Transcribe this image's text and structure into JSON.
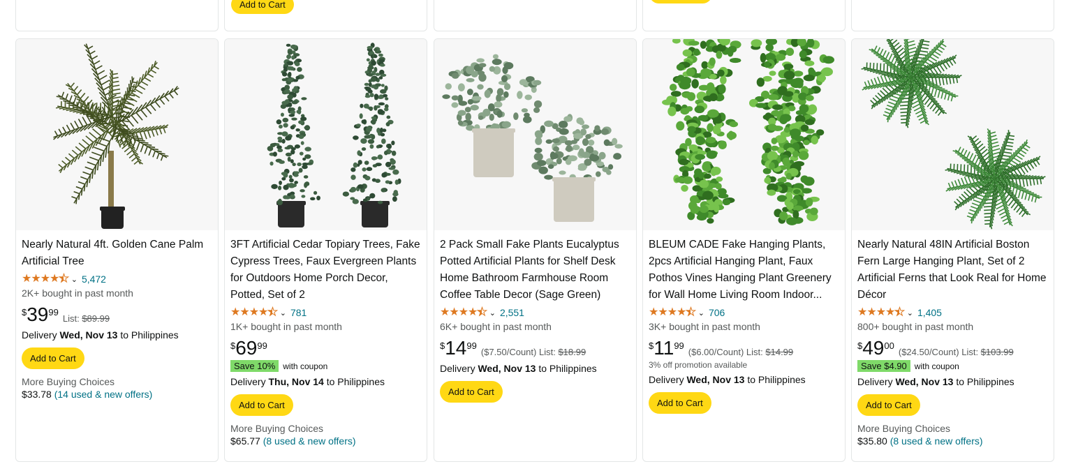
{
  "top_row": {
    "cart_label": "Add to Cart"
  },
  "products": [
    {
      "title": "Nearly Natural 4ft. Golden Cane Palm Artificial Tree",
      "rating": 4.5,
      "rating_count": "5,472",
      "bought": "2K+ bought in past month",
      "price_symbol": "$",
      "price_whole": "39",
      "price_fraction": "99",
      "unit_price": "",
      "list_label": "List:",
      "list_price": "$89.99",
      "coupon_badge": "",
      "coupon_text": "",
      "promo": "",
      "delivery_prefix": "Delivery",
      "delivery_date": "Wed, Nov 13",
      "delivery_suffix": "to Philippines",
      "cart_label": "Add to Cart",
      "more_buying": "More Buying Choices",
      "offer_price": "$33.78",
      "offer_link": "(14 used & new offers)",
      "image": "palm-tree"
    },
    {
      "title": "3FT Artificial Cedar Topiary Trees, Fake Cypress Trees, Faux Evergreen Plants for Outdoors Home Porch Decor, Potted, Set of 2",
      "rating": 4.5,
      "rating_count": "781",
      "bought": "1K+ bought in past month",
      "price_symbol": "$",
      "price_whole": "69",
      "price_fraction": "99",
      "unit_price": "",
      "list_label": "",
      "list_price": "",
      "coupon_badge": "Save 10%",
      "coupon_text": "with coupon",
      "promo": "",
      "delivery_prefix": "Delivery",
      "delivery_date": "Thu, Nov 14",
      "delivery_suffix": "to Philippines",
      "cart_label": "Add to Cart",
      "more_buying": "More Buying Choices",
      "offer_price": "$65.77",
      "offer_link": "(8 used & new offers)",
      "image": "cedar-trees"
    },
    {
      "title": "2 Pack Small Fake Plants Eucalyptus Potted Artificial Plants for Shelf Desk Home Bathroom Farmhouse Room Coffee Table Decor (Sage Green)",
      "rating": 4.5,
      "rating_count": "2,551",
      "bought": "6K+ bought in past month",
      "price_symbol": "$",
      "price_whole": "14",
      "price_fraction": "99",
      "unit_price": "($7.50/Count)",
      "list_label": "List:",
      "list_price": "$18.99",
      "coupon_badge": "",
      "coupon_text": "",
      "promo": "",
      "delivery_prefix": "Delivery",
      "delivery_date": "Wed, Nov 13",
      "delivery_suffix": "to Philippines",
      "cart_label": "Add to Cart",
      "more_buying": "",
      "offer_price": "",
      "offer_link": "",
      "image": "eucalyptus-pots"
    },
    {
      "title": "BLEUM CADE Fake Hanging Plants, 2pcs Artificial Hanging Plant, Faux Pothos Vines Hanging Plant Greenery for Wall Home Living Room Indoor...",
      "rating": 4.5,
      "rating_count": "706",
      "bought": "3K+ bought in past month",
      "price_symbol": "$",
      "price_whole": "11",
      "price_fraction": "99",
      "unit_price": "($6.00/Count)",
      "list_label": "List:",
      "list_price": "$14.99",
      "coupon_badge": "",
      "coupon_text": "",
      "promo": "3% off promotion available",
      "delivery_prefix": "Delivery",
      "delivery_date": "Wed, Nov 13",
      "delivery_suffix": "to Philippines",
      "cart_label": "Add to Cart",
      "more_buying": "",
      "offer_price": "",
      "offer_link": "",
      "image": "pothos-vines"
    },
    {
      "title": "Nearly Natural 48IN Artificial Boston Fern Large Hanging Plant, Set of 2 Artificial Ferns that Look Real for Home Décor",
      "rating": 4.5,
      "rating_count": "1,405",
      "bought": "800+ bought in past month",
      "price_symbol": "$",
      "price_whole": "49",
      "price_fraction": "00",
      "unit_price": "($24.50/Count)",
      "list_label": "List:",
      "list_price": "$103.99",
      "coupon_badge": "Save $4.90",
      "coupon_text": "with coupon",
      "promo": "",
      "delivery_prefix": "Delivery",
      "delivery_date": "Wed, Nov 13",
      "delivery_suffix": "to Philippines",
      "cart_label": "Add to Cart",
      "more_buying": "More Buying Choices",
      "offer_price": "$35.80",
      "offer_link": "(8 used & new offers)",
      "image": "boston-ferns"
    }
  ],
  "colors": {
    "star": "#de7921",
    "link": "#007185",
    "cart_button": "#ffd814",
    "coupon_badge": "#7fda69"
  }
}
